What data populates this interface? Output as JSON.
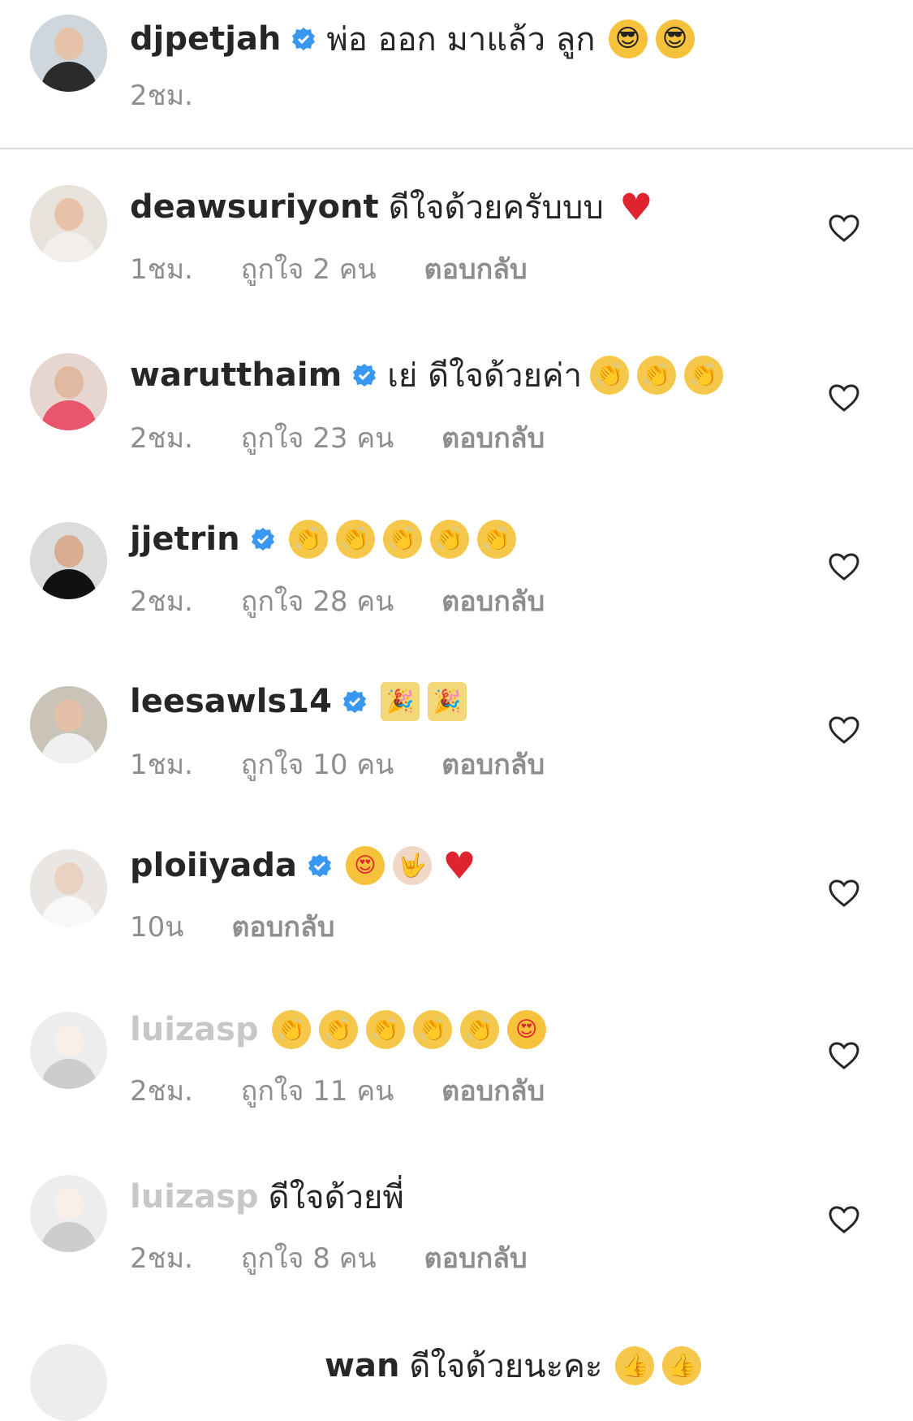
{
  "caption": {
    "username": "djpetjah",
    "text": "พ่อ ออก มาแล้ว ลูก",
    "emojis": [
      "smiling-face-with-sunglasses",
      "smiling-face-with-sunglasses"
    ],
    "time": "2ชม."
  },
  "comments": [
    {
      "username": "deawsuriyont",
      "verified": false,
      "text": "ดีใจด้วยครับบบ",
      "emojis": [
        "red-heart"
      ],
      "time": "1ชม.",
      "likes": "ถูกใจ 2 คน",
      "reply": "ตอบกลับ"
    },
    {
      "username": "warutthaim",
      "verified": true,
      "text": "เย่ ดีใจด้วยค่า",
      "emojis": [
        "clapping-hands",
        "clapping-hands",
        "clapping-hands"
      ],
      "time": "2ชม.",
      "likes": "ถูกใจ 23 คน",
      "reply": "ตอบกลับ"
    },
    {
      "username": "jjetrin",
      "verified": true,
      "text": "",
      "emojis": [
        "clapping-hands",
        "clapping-hands",
        "clapping-hands",
        "clapping-hands",
        "clapping-hands"
      ],
      "time": "2ชม.",
      "likes": "ถูกใจ 28 คน",
      "reply": "ตอบกลับ"
    },
    {
      "username": "leesawls14",
      "verified": true,
      "text": "",
      "emojis": [
        "party-popper",
        "party-popper"
      ],
      "time": "1ชม.",
      "likes": "ถูกใจ 10 คน",
      "reply": "ตอบกลับ"
    },
    {
      "username": "ploiiyada",
      "verified": true,
      "text": "",
      "emojis": [
        "heart-eyes",
        "love-you-gesture",
        "red-heart"
      ],
      "time": "10น",
      "likes": "",
      "reply": "ตอบกลับ"
    },
    {
      "username": "luizasp",
      "verified": false,
      "text": "",
      "emojis": [
        "clapping-hands",
        "clapping-hands",
        "clapping-hands",
        "clapping-hands",
        "clapping-hands",
        "heart-eyes"
      ],
      "time": "2ชม.",
      "likes": "ถูกใจ 11 คน",
      "reply": "ตอบกลับ"
    },
    {
      "username": "luizasp",
      "verified": false,
      "text": "ดีใจด้วยพี่",
      "emojis": [],
      "time": "2ชม.",
      "likes": "ถูกใจ 8 คน",
      "reply": "ตอบกลับ"
    },
    {
      "username": "wan",
      "verified": false,
      "text": "ดีใจด้วยนะคะ",
      "emojis": [
        "thumbs-up",
        "thumbs-up"
      ],
      "time": "",
      "likes": "",
      "reply": ""
    }
  ],
  "colors": {
    "verified": "#3897f0",
    "text": "#262626",
    "meta": "#8e8e8e",
    "heart": "#e0242f",
    "divider": "#dbdbdb"
  }
}
